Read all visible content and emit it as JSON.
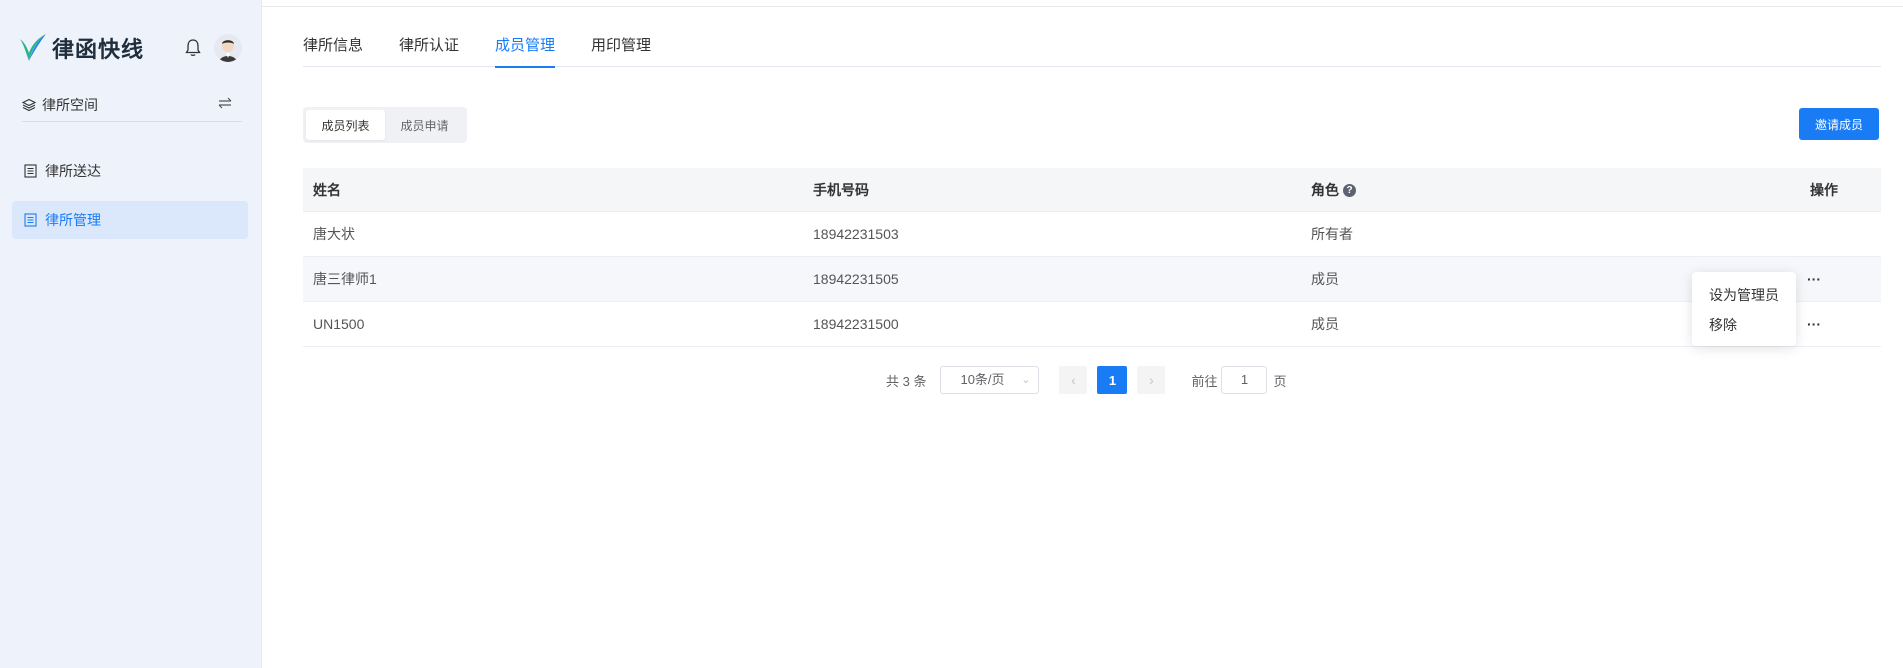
{
  "sidebar": {
    "logo_text": "律函快线",
    "space_label": "律所空间",
    "items": [
      {
        "label": "律所送达",
        "active": false
      },
      {
        "label": "律所管理",
        "active": true
      }
    ]
  },
  "tabs": [
    {
      "label": "律所信息",
      "active": false
    },
    {
      "label": "律所认证",
      "active": false
    },
    {
      "label": "成员管理",
      "active": true
    },
    {
      "label": "用印管理",
      "active": false
    }
  ],
  "segment": {
    "members_list": "成员列表",
    "member_requests": "成员申请"
  },
  "invite_button": "邀请成员",
  "table": {
    "headers": {
      "name": "姓名",
      "phone": "手机号码",
      "role": "角色",
      "actions": "操作"
    },
    "rows": [
      {
        "name": "唐大状",
        "phone": "18942231503",
        "role": "所有者",
        "actions": ""
      },
      {
        "name": "唐三律师1",
        "phone": "18942231505",
        "role": "成员",
        "actions": "···"
      },
      {
        "name": "UN1500",
        "phone": "18942231500",
        "role": "成员",
        "actions": "···"
      }
    ]
  },
  "row_menu": {
    "set_admin": "设为管理员",
    "remove": "移除"
  },
  "pagination": {
    "total": "共 3 条",
    "page_size": "10条/页",
    "current_page": "1",
    "goto_label": "前往",
    "goto_value": "1",
    "page_suffix": "页"
  },
  "colors": {
    "accent": "#1a7cf5",
    "sidebar_bg": "#eef3fb"
  }
}
